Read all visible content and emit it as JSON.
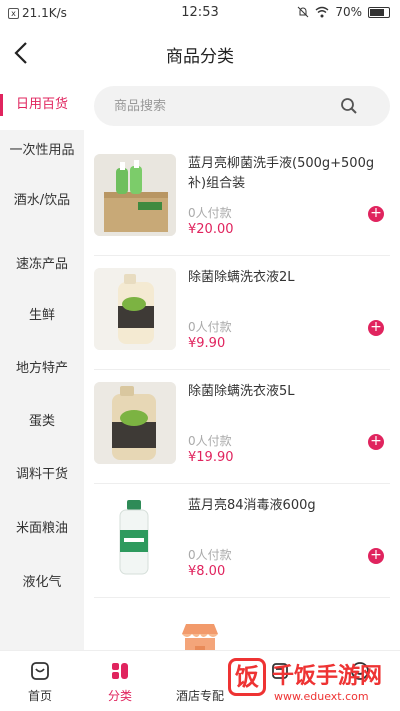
{
  "status_bar": {
    "network_speed": "21.1K/s",
    "time": "12:53",
    "battery": "70%"
  },
  "header": {
    "back_icon": "chevron-left-icon",
    "title": "商品分类"
  },
  "search": {
    "placeholder": "商品搜索",
    "icon": "search-icon"
  },
  "sidebar": {
    "items": [
      {
        "label": "日用百货",
        "active": true
      },
      {
        "label": "一次性用品",
        "active": false
      },
      {
        "label": "酒水/饮品",
        "active": false
      },
      {
        "label": "速冻产品",
        "active": false
      },
      {
        "label": "生鲜",
        "active": false
      },
      {
        "label": "地方特产",
        "active": false
      },
      {
        "label": "蛋类",
        "active": false
      },
      {
        "label": "调料干货",
        "active": false
      },
      {
        "label": "米面粮油",
        "active": false
      },
      {
        "label": "液化气",
        "active": false
      }
    ]
  },
  "products": [
    {
      "name": "蓝月亮柳菌洗手液(500g+500g补)组合装",
      "sold": "0人付款",
      "price": "¥20.00"
    },
    {
      "name": "除菌除螨洗衣液2L",
      "sold": "0人付款",
      "price": "¥9.90"
    },
    {
      "name": "除菌除螨洗衣液5L",
      "sold": "0人付款",
      "price": "¥19.90"
    },
    {
      "name": "蓝月亮84消毒液600g",
      "sold": "0人付款",
      "price": "¥8.00"
    }
  ],
  "tabbar": {
    "items": [
      {
        "label": "首页",
        "icon": "home-icon",
        "active": false
      },
      {
        "label": "分类",
        "icon": "category-icon",
        "active": true
      },
      {
        "label": "酒店专配",
        "icon": "shop-icon",
        "active": false
      },
      {
        "label": "",
        "icon": "cart-icon",
        "active": false
      },
      {
        "label": "",
        "icon": "user-icon",
        "active": false
      }
    ]
  },
  "watermark": {
    "logo": "饭",
    "text": "千饭手游网",
    "url": "www.eduext.com"
  },
  "colors": {
    "accent": "#e0245e",
    "sidebar_bg": "#f3f3f3",
    "search_bg": "#f2f2f2"
  }
}
